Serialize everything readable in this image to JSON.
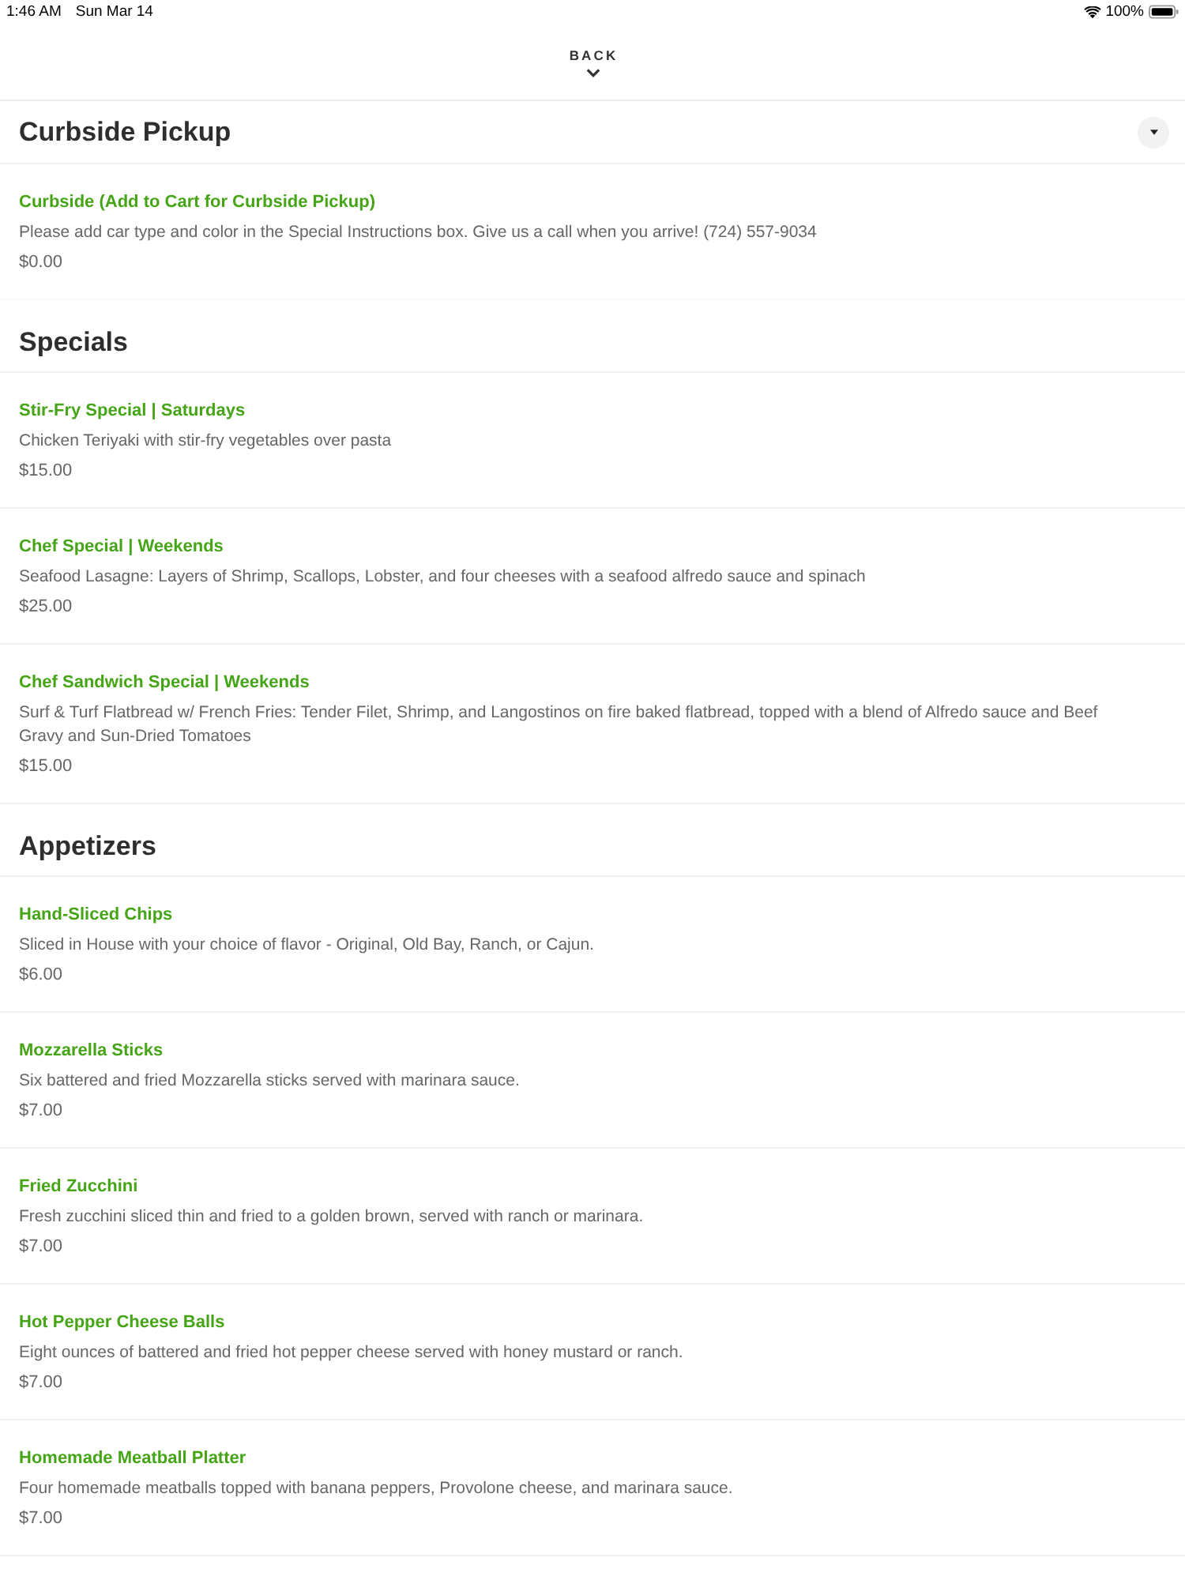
{
  "status_bar": {
    "time": "1:46 AM",
    "date": "Sun Mar 14",
    "battery": "100%"
  },
  "header": {
    "back_label": "BACK"
  },
  "sections": [
    {
      "title": "Curbside Pickup",
      "has_toggle": true,
      "items": [
        {
          "name": "Curbside (Add to Cart for Curbside Pickup)",
          "description": "Please add car type and color in the Special Instructions box. Give us a call when you arrive! (724) 557-9034",
          "price": "$0.00"
        }
      ]
    },
    {
      "title": "Specials",
      "has_toggle": false,
      "items": [
        {
          "name": "Stir-Fry Special | Saturdays",
          "description": "Chicken Teriyaki with stir-fry vegetables over pasta",
          "price": "$15.00"
        },
        {
          "name": "Chef Special | Weekends",
          "description": "Seafood Lasagne: Layers of Shrimp, Scallops, Lobster, and four cheeses with a seafood alfredo sauce and spinach",
          "price": "$25.00"
        },
        {
          "name": "Chef Sandwich Special | Weekends",
          "description": "Surf & Turf Flatbread w/ French Fries: Tender Filet, Shrimp, and Langostinos on fire baked flatbread, topped with a blend of Alfredo sauce and Beef Gravy and Sun-Dried Tomatoes",
          "price": "$15.00"
        }
      ]
    },
    {
      "title": "Appetizers",
      "has_toggle": false,
      "items": [
        {
          "name": "Hand-Sliced Chips",
          "description": "Sliced in House with your choice of flavor - Original, Old Bay, Ranch, or Cajun.",
          "price": "$6.00"
        },
        {
          "name": "Mozzarella Sticks",
          "description": "Six battered and fried Mozzarella sticks served with marinara sauce.",
          "price": "$7.00"
        },
        {
          "name": "Fried Zucchini",
          "description": "Fresh zucchini sliced thin and fried to a golden brown, served with ranch or marinara.",
          "price": "$7.00"
        },
        {
          "name": "Hot Pepper Cheese Balls",
          "description": "Eight ounces of battered and fried hot pepper cheese served with honey mustard or ranch.",
          "price": "$7.00"
        },
        {
          "name": "Homemade Meatball Platter",
          "description": "Four homemade meatballs topped with banana peppers, Provolone cheese, and marinara sauce.",
          "price": "$7.00"
        }
      ]
    }
  ]
}
